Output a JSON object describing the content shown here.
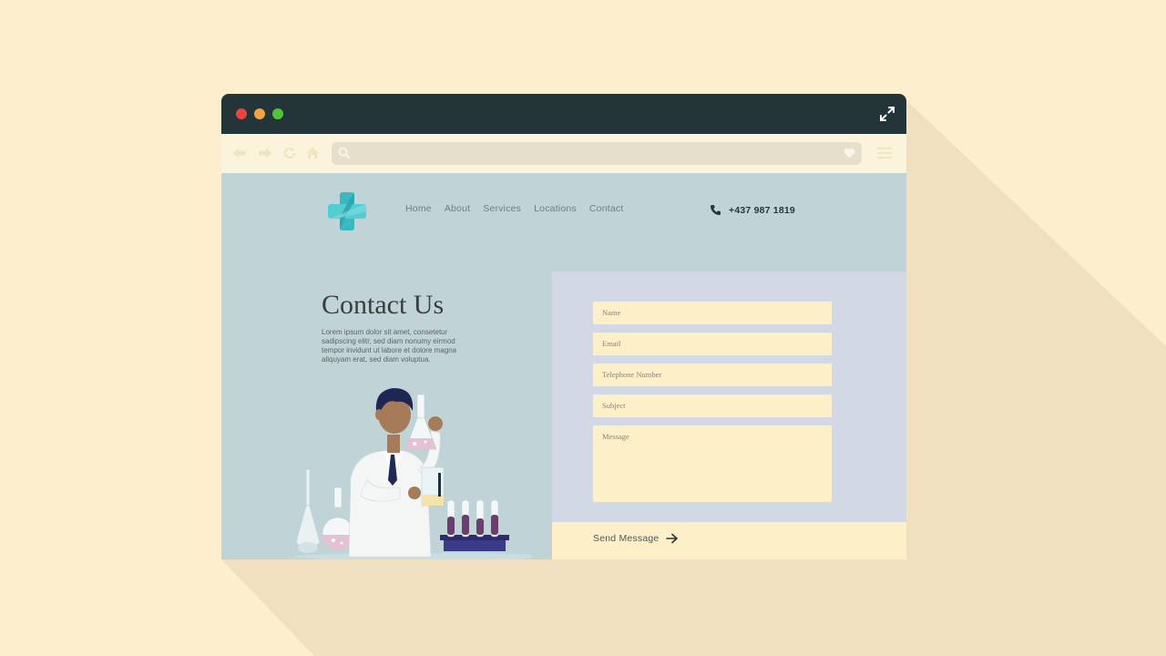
{
  "nav": {
    "links": [
      "Home",
      "About",
      "Services",
      "Locations",
      "Contact"
    ],
    "phone": "+437 987 1819"
  },
  "hero": {
    "title": "Contact Us",
    "text": "Lorem ipsum dolor sit amet, consetetur sadipscing elitr, sed diam nonumy eirmod tempor invidunt ut labore et dolore magna aliquyam erat, sed diam voluptua."
  },
  "form": {
    "name_placeholder": "Name",
    "email_placeholder": "Email",
    "telephone_placeholder": "Telephone Number",
    "subject_placeholder": "Subject",
    "message_placeholder": "Message",
    "send_label": "Send Message"
  },
  "icons": {
    "window_controls": [
      "close-icon",
      "minimize-icon",
      "maximize-icon"
    ],
    "titlebar": "expand-icon",
    "toolbar": [
      "back-arrow-icon",
      "forward-arrow-icon",
      "refresh-icon",
      "home-icon",
      "search-icon",
      "heart-icon",
      "menu-icon"
    ],
    "logo": "medical-cross-logo",
    "phone": "phone-icon",
    "send": "arrow-right-icon"
  },
  "colors": {
    "background": "#fdefcd",
    "titlebar": "#233539",
    "toolbar": "#fbf3dc",
    "page": "#c0d4d7",
    "form_panel": "#d2d9e5",
    "field": "#fdefc8",
    "accent": "#3bb8c0"
  }
}
